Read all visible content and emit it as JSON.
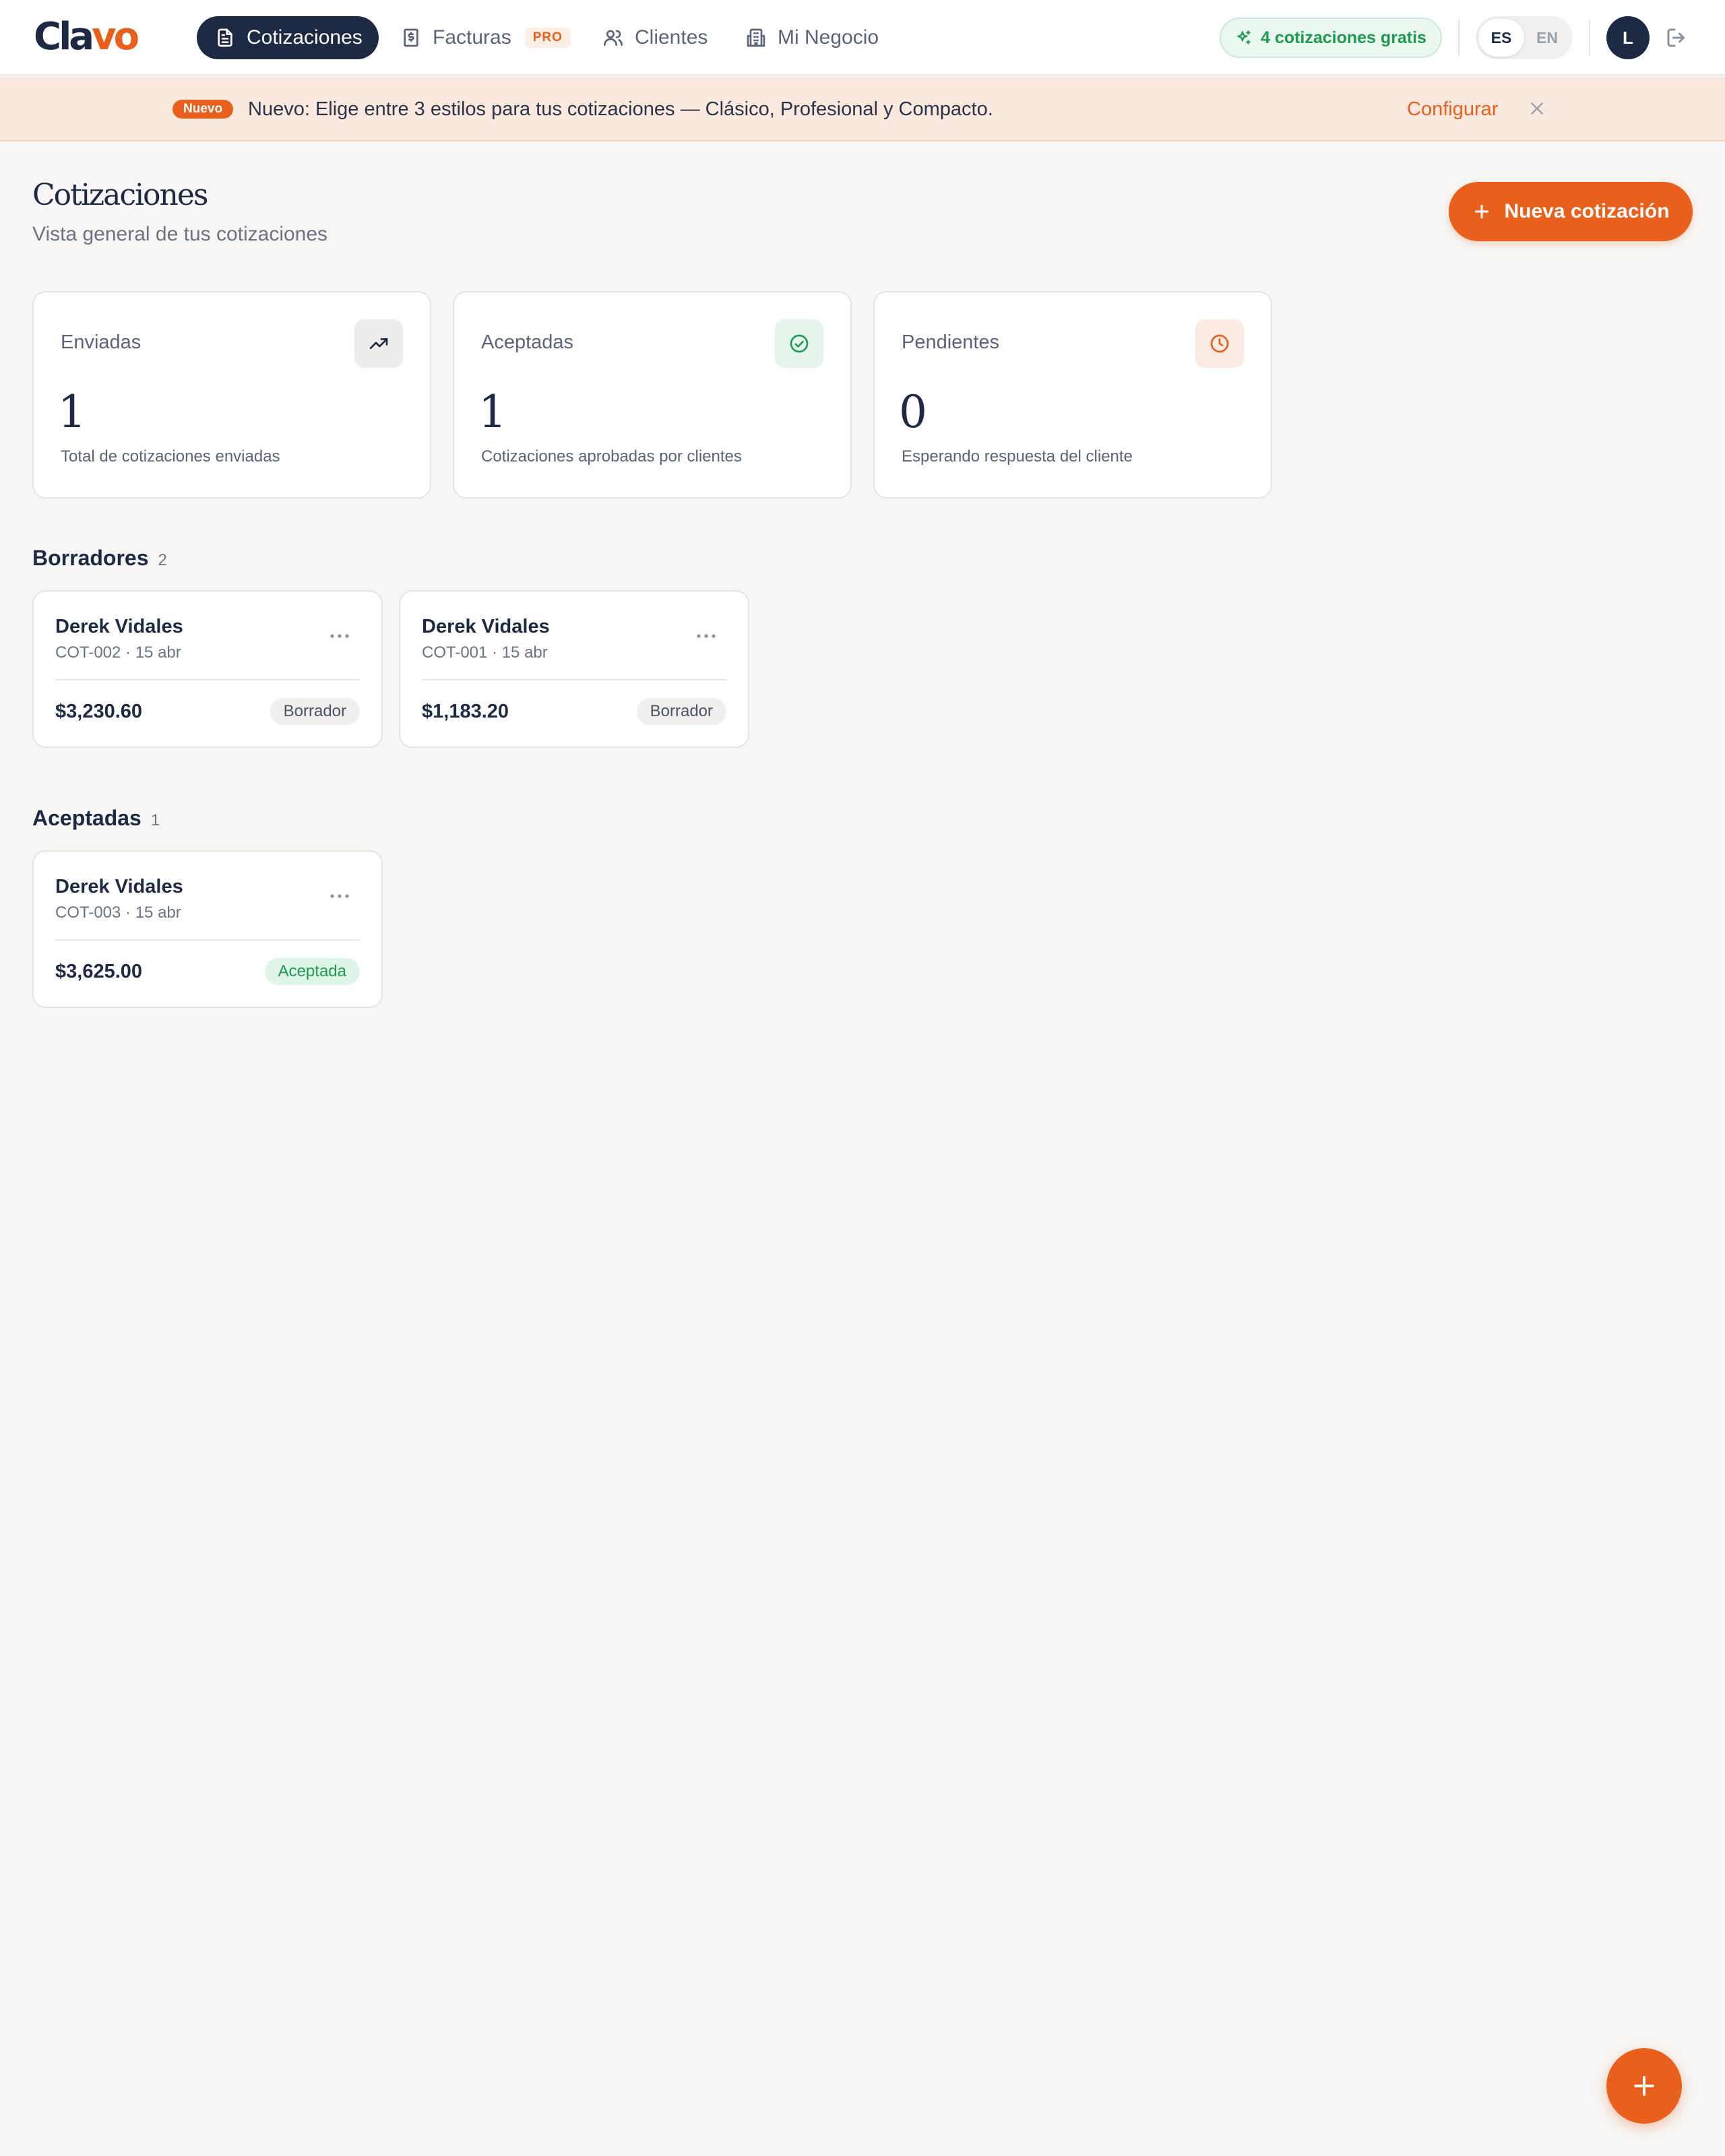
{
  "brand": {
    "part1": "Cla",
    "part2": "vo"
  },
  "nav": {
    "items": [
      {
        "label": "Cotizaciones",
        "icon": "document-icon",
        "active": true
      },
      {
        "label": "Facturas",
        "icon": "receipt-icon",
        "badge": "PRO"
      },
      {
        "label": "Clientes",
        "icon": "users-icon"
      },
      {
        "label": "Mi Negocio",
        "icon": "building-icon"
      }
    ],
    "free_quotes": "4 cotizaciones gratis",
    "lang": {
      "es": "ES",
      "en": "EN",
      "selected": "ES"
    },
    "avatar_initial": "L"
  },
  "banner": {
    "badge": "Nuevo",
    "text": "Nuevo: Elige entre 3 estilos para tus cotizaciones — Clásico, Profesional y Compacto.",
    "link": "Configurar"
  },
  "header": {
    "title": "Cotizaciones",
    "subtitle": "Vista general de tus cotizaciones",
    "new_button": "Nueva cotización"
  },
  "stats": [
    {
      "label": "Enviadas",
      "value": "1",
      "desc": "Total de cotizaciones enviadas",
      "icon": "trending-up-icon"
    },
    {
      "label": "Aceptadas",
      "value": "1",
      "desc": "Cotizaciones aprobadas por clientes",
      "icon": "check-circle-icon"
    },
    {
      "label": "Pendientes",
      "value": "0",
      "desc": "Esperando respuesta del cliente",
      "icon": "clock-icon"
    }
  ],
  "sections": {
    "drafts": {
      "title": "Borradores",
      "count": "2",
      "cards": [
        {
          "client": "Derek Vidales",
          "meta": "COT-002 · 15 abr",
          "amount": "$3,230.60",
          "status": "Borrador"
        },
        {
          "client": "Derek Vidales",
          "meta": "COT-001 · 15 abr",
          "amount": "$1,183.20",
          "status": "Borrador"
        }
      ]
    },
    "accepted": {
      "title": "Aceptadas",
      "count": "1",
      "cards": [
        {
          "client": "Derek Vidales",
          "meta": "COT-003 · 15 abr",
          "amount": "$3,625.00",
          "status": "Aceptada"
        }
      ]
    }
  },
  "colors": {
    "accent": "#e8601c",
    "navy": "#1e2a44",
    "success": "#1f9a52",
    "banner_bg": "#fbe8df",
    "page_bg": "#f7f6f4"
  }
}
